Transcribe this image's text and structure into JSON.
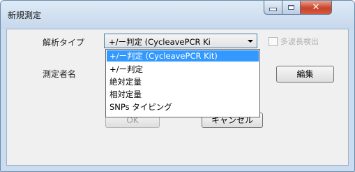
{
  "window": {
    "title": "新規測定",
    "controls": {
      "minimize": "minimize",
      "maximize": "maximize",
      "close": "x"
    }
  },
  "form": {
    "analysis_type_label": "解析タイプ",
    "analysis_type_value": "+/ー判定 (CycleavePCR Ki",
    "checkbox_label": "多波長検出",
    "checkbox_checked": false,
    "operator_label": "測定者名",
    "edit_button": "編集",
    "ok_button": "OK",
    "cancel_button": "キャンセル"
  },
  "dropdown": {
    "options": [
      "+/ー判定 (CycleavePCR Kit)",
      "+/ー判定",
      "絶対定量",
      "相対定量",
      "SNPs タイピング"
    ],
    "selected_index": 0
  },
  "colors": {
    "selection": "#3399ff",
    "close_button": "#c7432a",
    "frame": "#cbdcef"
  }
}
